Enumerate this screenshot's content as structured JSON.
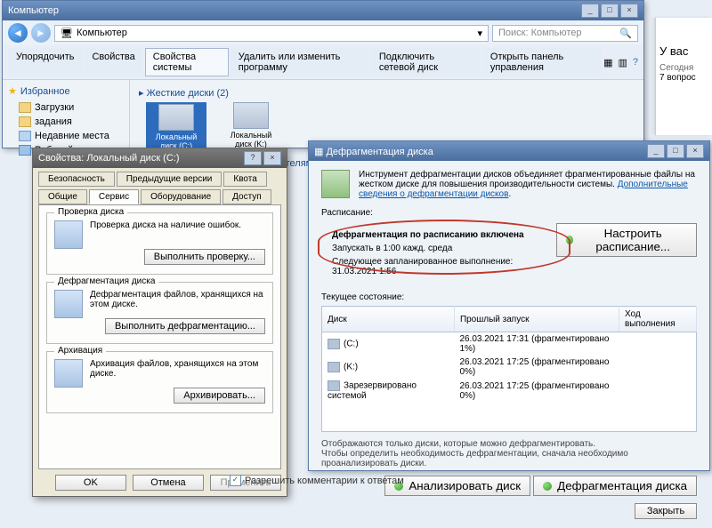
{
  "explorer": {
    "title": "Компьютер",
    "address": "Компьютер",
    "search_placeholder": "Поиск: Компьютер",
    "toolbar": {
      "organize": "Упорядочить",
      "properties": "Свойства",
      "system_properties": "Свойства системы",
      "uninstall": "Удалить или изменить программу",
      "map_drive": "Подключить сетевой диск",
      "control_panel": "Открыть панель управления"
    },
    "sidebar": {
      "header": "Избранное",
      "items": [
        "Загрузки",
        "задания",
        "Недавние места",
        "Рабочий стол"
      ]
    },
    "sections": {
      "hdd": "Жесткие диски (2)",
      "removable": "Устройства со съемными носителями (2)"
    },
    "drives": [
      {
        "label1": "Локальный",
        "label2": "диск (C:)",
        "selected": true
      },
      {
        "label1": "Локальный",
        "label2": "диск (K:)",
        "selected": false
      }
    ]
  },
  "props": {
    "title": "Свойства: Локальный диск (C:)",
    "tabs_row1": [
      "Безопасность",
      "Предыдущие версии",
      "Квота"
    ],
    "tabs_row2": [
      "Общие",
      "Сервис",
      "Оборудование",
      "Доступ"
    ],
    "active_tab": "Сервис",
    "check": {
      "group": "Проверка диска",
      "text": "Проверка диска на наличие ошибок.",
      "btn": "Выполнить проверку..."
    },
    "defrag": {
      "group": "Дефрагментация диска",
      "text": "Дефрагментация файлов, хранящихся на этом диске.",
      "btn": "Выполнить дефрагментацию..."
    },
    "archive": {
      "group": "Архивация",
      "text": "Архивация файлов, хранящихся на этом диске.",
      "btn": "Архивировать..."
    },
    "buttons": {
      "ok": "OK",
      "cancel": "Отмена",
      "apply": "Применить"
    }
  },
  "defrag": {
    "title": "Дефрагментация диска",
    "info": "Инструмент дефрагментации дисков объединяет фрагментированные файлы на жестком диске для повышения производительности системы.",
    "link": "Дополнительные сведения о дефрагментации дисков",
    "schedule_hdr": "Расписание:",
    "schedule_on": "Дефрагментация по расписанию включена",
    "schedule_when": "Запускать в 1:00 кажд. среда",
    "schedule_next": "Следующее запланированное выполнение: 31.03.2021 1:56",
    "configure_btn": "Настроить расписание...",
    "current_hdr": "Текущее состояние:",
    "columns": {
      "disk": "Диск",
      "last": "Прошлый запуск",
      "progress": "Ход выполнения"
    },
    "rows": [
      {
        "name": "(C:)",
        "last": "26.03.2021 17:31 (фрагментировано 1%)"
      },
      {
        "name": "(K:)",
        "last": "26.03.2021 17:25 (фрагментировано 0%)"
      },
      {
        "name": "Зарезервировано системой",
        "last": "26.03.2021 17:25 (фрагментировано 0%)"
      }
    ],
    "note1": "Отображаются только диски, которые можно дефрагментировать.",
    "note2": "Чтобы определить необходимость дефрагментации, сначала необходимо проанализировать диски.",
    "analyze_btn": "Анализировать диск",
    "defrag_btn": "Дефрагментация диска",
    "close_btn": "Закрыть"
  },
  "rightpane": {
    "heading": "У вас",
    "sub1": "Сегодня",
    "sub2": "7 вопрос"
  },
  "bottom": {
    "allow_comments": "Разрешить комментарии к ответам"
  }
}
